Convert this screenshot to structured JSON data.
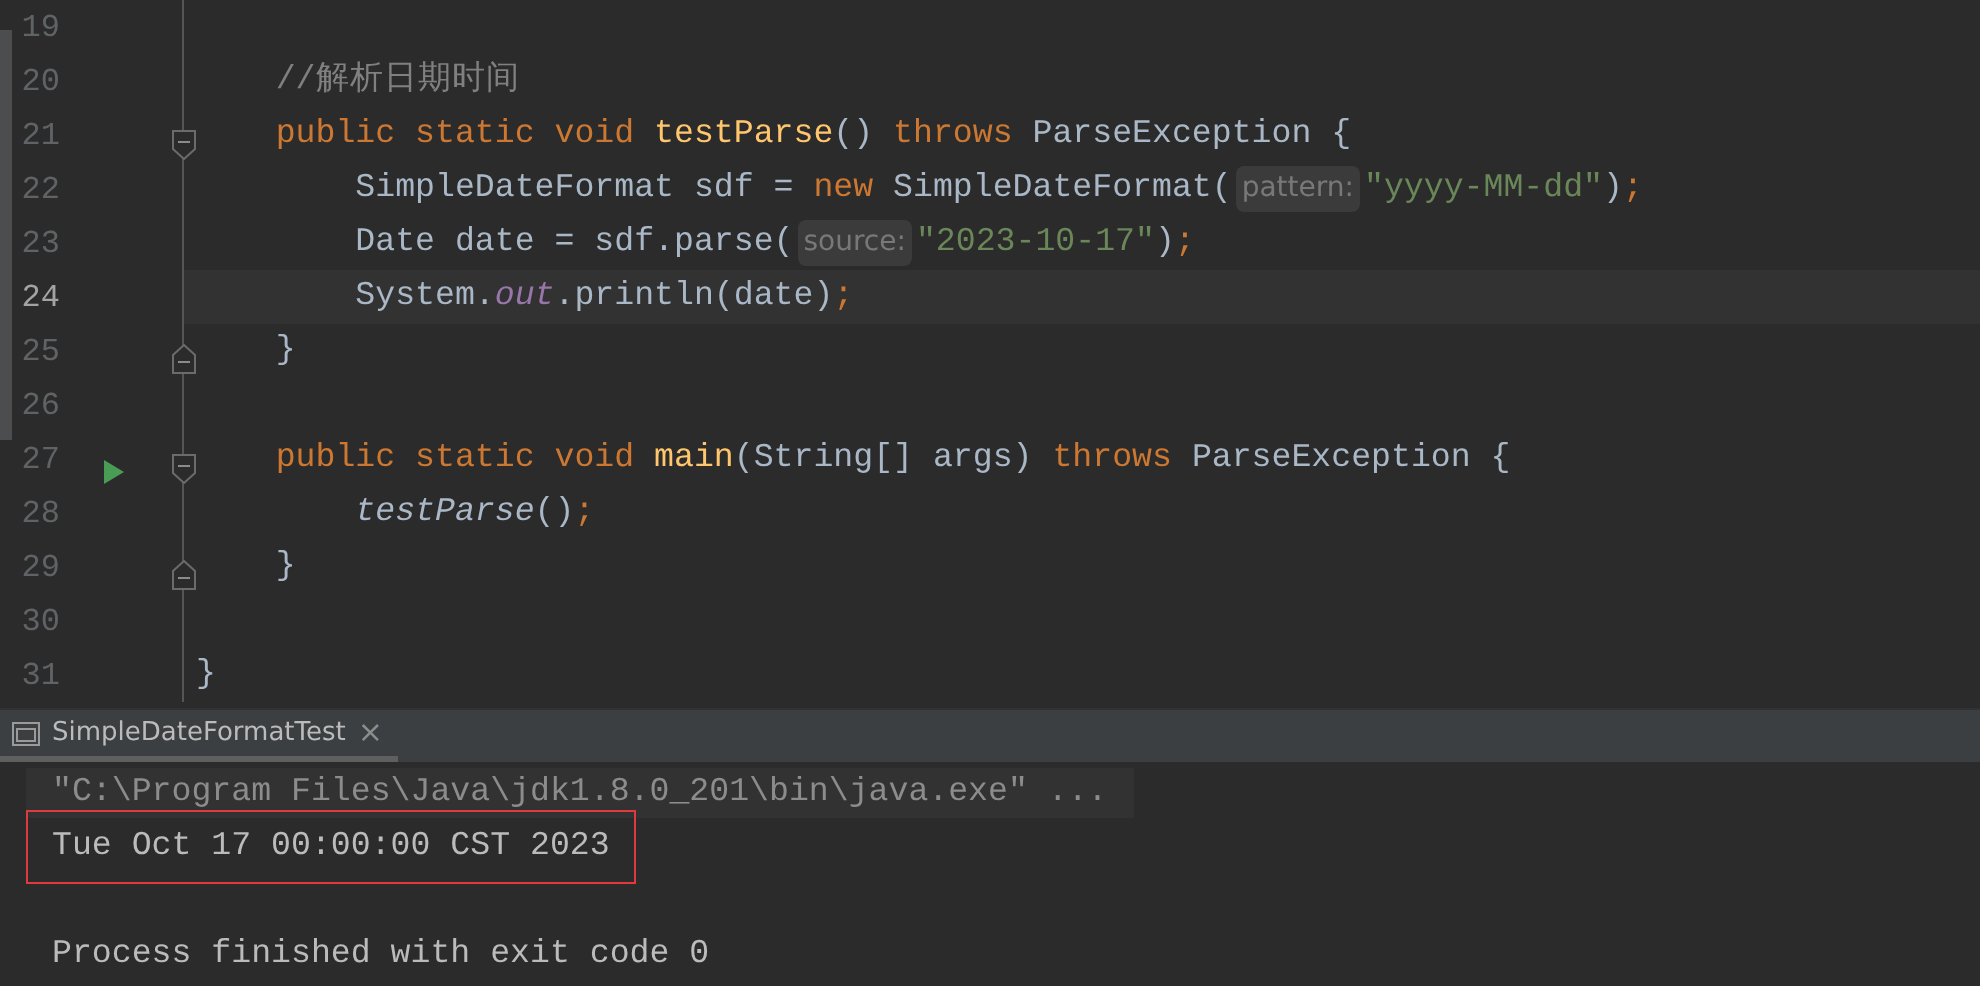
{
  "editor": {
    "lines": [
      {
        "number": "19",
        "current": false
      },
      {
        "number": "20",
        "current": false,
        "tokens": [
          {
            "kind": "comment",
            "text": "    //解析日期时间"
          }
        ]
      },
      {
        "number": "21",
        "current": false,
        "fold_start": true,
        "tokens": [
          {
            "kind": "keyword",
            "text": "    public static void "
          },
          {
            "kind": "function",
            "text": "testParse"
          },
          {
            "kind": "plain",
            "text": "() "
          },
          {
            "kind": "keyword",
            "text": "throws "
          },
          {
            "kind": "plain",
            "text": "ParseException {"
          }
        ]
      },
      {
        "number": "22",
        "current": false,
        "tokens": [
          {
            "kind": "plain",
            "text": "        SimpleDateFormat sdf = "
          },
          {
            "kind": "keyword",
            "text": "new "
          },
          {
            "kind": "plain",
            "text": "SimpleDateFormat("
          },
          {
            "kind": "hint",
            "text": "pattern:"
          },
          {
            "kind": "string",
            "text": "\"yyyy-MM-dd\""
          },
          {
            "kind": "plain",
            "text": ")"
          },
          {
            "kind": "keyword",
            "text": ";"
          }
        ]
      },
      {
        "number": "23",
        "current": false,
        "tokens": [
          {
            "kind": "plain",
            "text": "        Date date = sdf.parse("
          },
          {
            "kind": "hint",
            "text": "source:"
          },
          {
            "kind": "string",
            "text": "\"2023-10-17\""
          },
          {
            "kind": "plain",
            "text": ")"
          },
          {
            "kind": "keyword",
            "text": ";"
          }
        ]
      },
      {
        "number": "24",
        "current": true,
        "tokens": [
          {
            "kind": "plain",
            "text": "        System."
          },
          {
            "kind": "static",
            "text": "out"
          },
          {
            "kind": "plain",
            "text": ".println(date)"
          },
          {
            "kind": "keyword",
            "text": ";"
          }
        ]
      },
      {
        "number": "25",
        "current": false,
        "fold_end": true,
        "tokens": [
          {
            "kind": "plain",
            "text": "    }"
          }
        ]
      },
      {
        "number": "26",
        "current": false
      },
      {
        "number": "27",
        "current": false,
        "run": true,
        "fold_start": true,
        "tokens": [
          {
            "kind": "keyword",
            "text": "    public static void "
          },
          {
            "kind": "function",
            "text": "main"
          },
          {
            "kind": "plain",
            "text": "(String[] args) "
          },
          {
            "kind": "keyword",
            "text": "throws "
          },
          {
            "kind": "plain",
            "text": "ParseException {"
          }
        ]
      },
      {
        "number": "28",
        "current": false,
        "tokens": [
          {
            "kind": "italic",
            "text": "        testParse"
          },
          {
            "kind": "plain",
            "text": "()"
          },
          {
            "kind": "keyword",
            "text": ";"
          }
        ]
      },
      {
        "number": "29",
        "current": false,
        "fold_end": true,
        "tokens": [
          {
            "kind": "plain",
            "text": "    }"
          }
        ]
      },
      {
        "number": "30",
        "current": false
      },
      {
        "number": "31",
        "current": false,
        "tokens": [
          {
            "kind": "brace",
            "text": "}"
          }
        ]
      }
    ]
  },
  "console": {
    "tab": {
      "label": "SimpleDateFormatTest",
      "close": "×",
      "selected": true
    },
    "lines": [
      {
        "kind": "command",
        "text": "\"C:\\Program Files\\Java\\jdk1.8.0_201\\bin\\java.exe\" ...",
        "highlighted": false
      },
      {
        "kind": "output",
        "text": "Tue Oct 17 00:00:00 CST 2023",
        "highlighted": true
      },
      {
        "kind": "blank",
        "highlighted": false
      },
      {
        "kind": "output",
        "text": "Process finished with exit code 0",
        "highlighted": false
      }
    ]
  }
}
